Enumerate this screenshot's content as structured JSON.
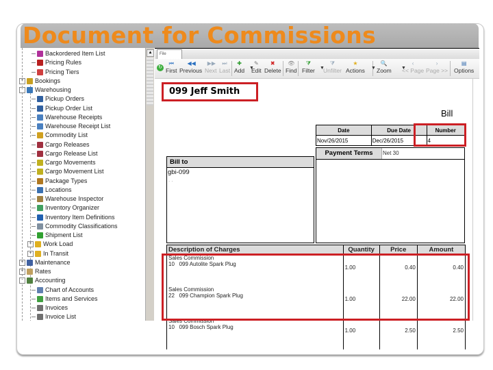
{
  "slide": {
    "title": "Document for Commissions"
  },
  "sidebar": {
    "items": [
      {
        "label": "Backordered Item List",
        "icon": "backorder-icon",
        "color": "#b0309a"
      },
      {
        "label": "Pricing Rules",
        "icon": "pricing-rules-icon",
        "color": "#b82020"
      },
      {
        "label": "Pricing Tiers",
        "icon": "pricing-tiers-icon",
        "color": "#d04040"
      },
      {
        "label": "Bookings",
        "icon": "bookings-icon",
        "color": "#c8a020",
        "expander": "+"
      },
      {
        "label": "Warehousing",
        "icon": "warehousing-icon",
        "color": "#3a78b8",
        "expander": "-"
      },
      {
        "label": "Pickup Orders",
        "icon": "pickup-orders-icon",
        "color": "#3060a0"
      },
      {
        "label": "Pickup Order List",
        "icon": "pickup-order-list-icon",
        "color": "#3060a0"
      },
      {
        "label": "Warehouse Receipts",
        "icon": "warehouse-receipts-icon",
        "color": "#4a80c0"
      },
      {
        "label": "Warehouse Receipt List",
        "icon": "warehouse-receipt-list-icon",
        "color": "#4a80c0"
      },
      {
        "label": "Commodity List",
        "icon": "commodity-list-icon",
        "color": "#d0a020"
      },
      {
        "label": "Cargo Releases",
        "icon": "cargo-releases-icon",
        "color": "#a03040"
      },
      {
        "label": "Cargo Release List",
        "icon": "cargo-release-list-icon",
        "color": "#a03040"
      },
      {
        "label": "Cargo Movements",
        "icon": "cargo-movements-icon",
        "color": "#c0b020"
      },
      {
        "label": "Cargo Movement List",
        "icon": "cargo-movement-list-icon",
        "color": "#c0b020"
      },
      {
        "label": "Package Types",
        "icon": "package-types-icon",
        "color": "#b07820"
      },
      {
        "label": "Locations",
        "icon": "locations-icon",
        "color": "#3a70b0"
      },
      {
        "label": "Warehouse Inspector",
        "icon": "warehouse-inspector-icon",
        "color": "#a08040"
      },
      {
        "label": "Inventory Organizer",
        "icon": "inventory-organizer-icon",
        "color": "#40a060"
      },
      {
        "label": "Inventory Item Definitions",
        "icon": "inventory-item-definitions-icon",
        "color": "#2060b0"
      },
      {
        "label": "Commodity Classifications",
        "icon": "commodity-classifications-icon",
        "color": "#8090a0"
      },
      {
        "label": "Shipment List",
        "icon": "shipment-list-icon",
        "color": "#30a030"
      },
      {
        "label": "Work Load",
        "icon": "work-load-icon",
        "color": "#e0b020",
        "expander": "+"
      },
      {
        "label": "In Transit",
        "icon": "in-transit-icon",
        "color": "#e0b020",
        "expander": "+"
      },
      {
        "label": "Maintenance",
        "icon": "maintenance-icon",
        "color": "#4060a0",
        "expander": "+"
      },
      {
        "label": "Rates",
        "icon": "rates-icon",
        "color": "#c0a060",
        "expander": "+"
      },
      {
        "label": "Accounting",
        "icon": "accounting-icon",
        "color": "#508040",
        "expander": "-"
      },
      {
        "label": "Chart of Accounts",
        "icon": "chart-of-accounts-icon",
        "color": "#6080b0"
      },
      {
        "label": "Items and Services",
        "icon": "items-services-icon",
        "color": "#40a040"
      },
      {
        "label": "Invoices",
        "icon": "invoices-icon",
        "color": "#707070"
      },
      {
        "label": "Invoice List",
        "icon": "invoice-list-icon",
        "color": "#707070"
      }
    ]
  },
  "main": {
    "tab_label": "File",
    "toolbar": {
      "buttons": [
        {
          "label": "First",
          "icon": "first-icon",
          "enabled": true
        },
        {
          "label": "Previous",
          "icon": "previous-icon",
          "enabled": true
        },
        {
          "label": "Next",
          "icon": "next-icon",
          "enabled": false
        },
        {
          "label": "Last",
          "icon": "last-icon",
          "enabled": false
        },
        {
          "label": "Add",
          "icon": "add-icon",
          "enabled": true
        },
        {
          "label": "Edit",
          "icon": "edit-icon",
          "enabled": true
        },
        {
          "label": "Delete",
          "icon": "delete-icon",
          "enabled": true
        },
        {
          "label": "Find",
          "icon": "find-icon",
          "enabled": true
        },
        {
          "label": "Filter",
          "icon": "filter-icon",
          "enabled": true
        },
        {
          "label": "Unfilter",
          "icon": "unfilter-icon",
          "enabled": false
        },
        {
          "label": "Actions",
          "icon": "actions-icon",
          "enabled": true
        },
        {
          "label": "Zoom",
          "icon": "zoom-icon",
          "enabled": true
        },
        {
          "label": "<< Page",
          "icon": "page-back-icon",
          "enabled": false
        },
        {
          "label": "Page >>",
          "icon": "page-forward-icon",
          "enabled": false
        },
        {
          "label": "Options",
          "icon": "options-icon",
          "enabled": true
        }
      ]
    },
    "document": {
      "agent_name": "099 Jeff Smith",
      "doc_type": "Bill",
      "date_header": "Date",
      "due_date_header": "Due Date",
      "number_header": "Number",
      "date": "Nov/26/2015",
      "due_date": "Dec/26/2015",
      "number": "4",
      "payment_terms_label": "Payment Terms",
      "payment_terms": "Net 30",
      "bill_to_label": "Bill to",
      "bill_to_value": "gbi-099",
      "bill_to_extra": ". .",
      "charges": {
        "headers": {
          "description": "Description of Charges",
          "quantity": "Quantity",
          "price": "Price",
          "amount": "Amount"
        },
        "rows": [
          {
            "line1": "Sales Commission",
            "line2": "10   099 Autolite Spark Plug",
            "quantity": "1.00",
            "price": "0.40",
            "amount": "0.40"
          },
          {
            "line1": "Sales Commission",
            "line2": "22   099 Champion Spark Plug",
            "quantity": "1.00",
            "price": "22.00",
            "amount": "22.00"
          },
          {
            "line1": "Sales Commission",
            "line2": "10   099 Bosch Spark Plug",
            "quantity": "1.00",
            "price": "2.50",
            "amount": "2.50"
          }
        ]
      }
    }
  },
  "colors": {
    "title": "#ee8a1c",
    "highlight": "#cc1f24",
    "header_bg": "#dcdcdc"
  }
}
